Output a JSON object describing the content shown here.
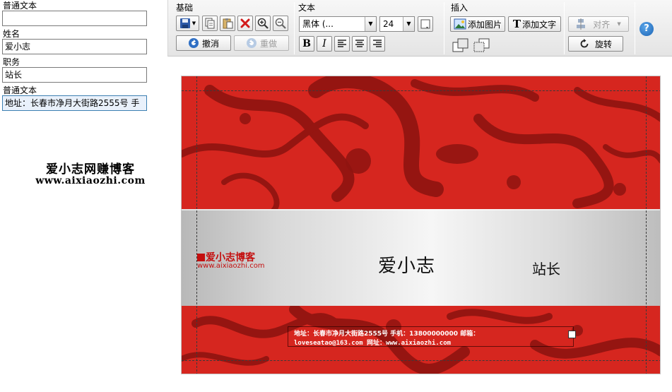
{
  "form": {
    "fields": [
      {
        "label": "普通文本",
        "value": ""
      },
      {
        "label": "姓名",
        "value": "爱小志"
      },
      {
        "label": "职务",
        "value": "站长"
      },
      {
        "label": "普通文本",
        "value": "地址：长春市净月大街路2555号 手"
      }
    ]
  },
  "watermark": {
    "line1": "爱小志网赚博客",
    "line2": "www.aixiaozhi.com"
  },
  "toolbar": {
    "groups": {
      "basic": "基础",
      "text": "文本",
      "insert": "插入"
    },
    "undo_label": "撤消",
    "redo_label": "重做",
    "font_family": "黑体 (...",
    "font_size": "24",
    "add_image_label": "添加图片",
    "add_text_label": "添加文字",
    "align_label": "对齐",
    "rotate_label": "旋转",
    "bold_label": "B",
    "italic_label": "I",
    "help_label": "?"
  },
  "card": {
    "name": "爱小志",
    "title": "站长",
    "logo_text": "爱小志博客",
    "logo_url": "www.aixiaozhi.com",
    "info_line1": "地址：长春市净月大街路2555号 手机：13800000000 邮箱：",
    "info_line2": "loveseatao@163.com 网址：www.aixiaozhi.com"
  },
  "colors": {
    "card_red": "#d6261f",
    "pattern_dark": "#8f1410",
    "accent_blue": "#1c64b4"
  }
}
